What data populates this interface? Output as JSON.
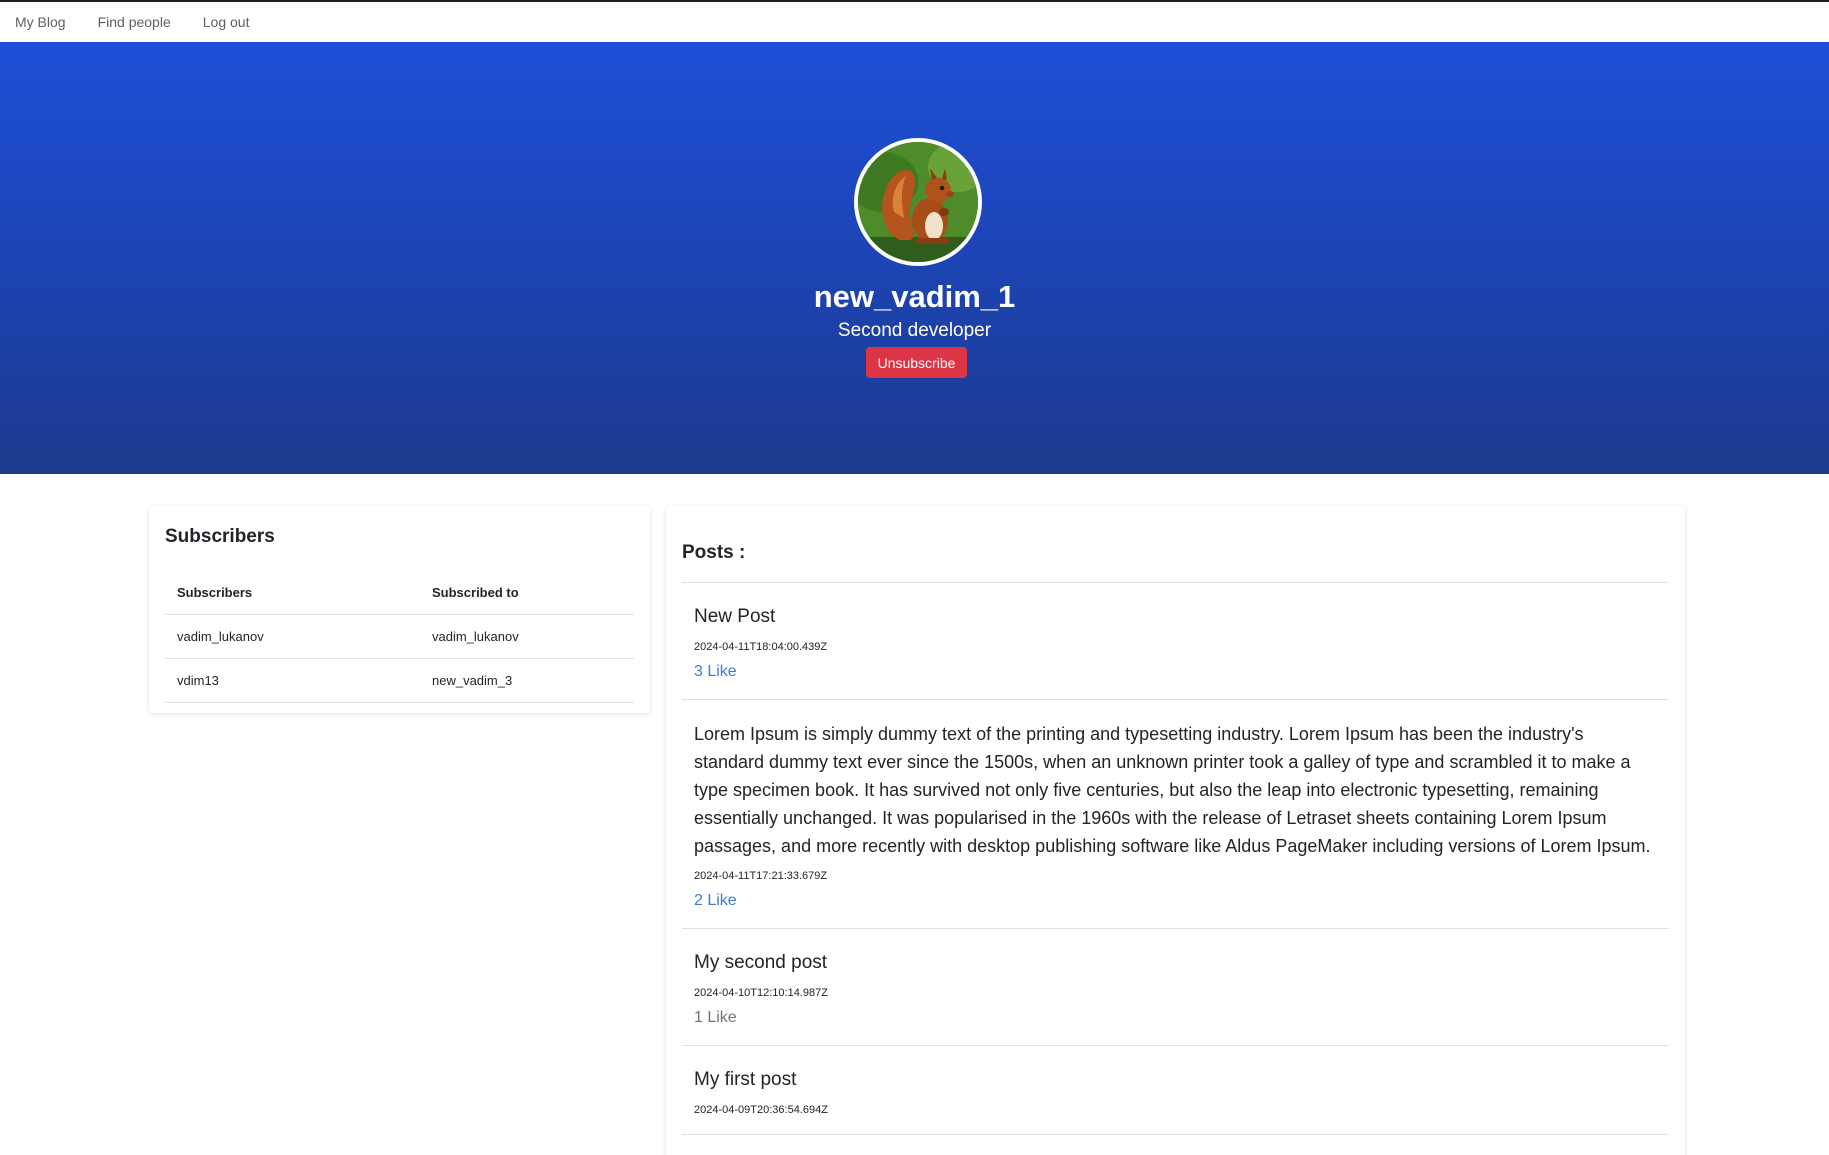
{
  "nav": {
    "my_blog": "My Blog",
    "find_people": "Find people",
    "log_out": "Log out"
  },
  "profile": {
    "username": "new_vadim_1",
    "role": "Second developer",
    "unsubscribe_label": "Unsubscribe",
    "avatar_icon": "squirrel-photo"
  },
  "subscribers": {
    "title": "Subscribers",
    "columns": [
      "Subscribers",
      "Subscribed to"
    ],
    "rows": [
      [
        "vadim_lukanov",
        "vadim_lukanov"
      ],
      [
        "vdim13",
        "new_vadim_3"
      ]
    ]
  },
  "posts": {
    "title": "Posts :",
    "items": [
      {
        "title": "New Post",
        "date": "2024-04-11T18:04:00.439Z",
        "like": "3 Like"
      },
      {
        "body": "Lorem Ipsum is simply dummy text of the printing and typesetting industry. Lorem Ipsum has been the industry's standard dummy text ever since the 1500s, when an unknown printer took a galley of type and scrambled it to make a type specimen book. It has survived not only five centuries, but also the leap into electronic typesetting, remaining essentially unchanged. It was popularised in the 1960s with the release of Letraset sheets containing Lorem Ipsum passages, and more recently with desktop publishing software like Aldus PageMaker including versions of Lorem Ipsum.",
        "date": "2024-04-11T17:21:33.679Z",
        "like": "2 Like"
      },
      {
        "title": "My second post",
        "date": "2024-04-10T12:10:14.987Z",
        "like": "1 Like"
      },
      {
        "title": "My first post",
        "date": "2024-04-09T20:36:54.694Z",
        "like": ""
      }
    ]
  },
  "colors": {
    "hero_top": "#1e4fd8",
    "hero_bottom": "#1e3a8e",
    "danger": "#dc3545",
    "link": "#3d7bd9"
  }
}
